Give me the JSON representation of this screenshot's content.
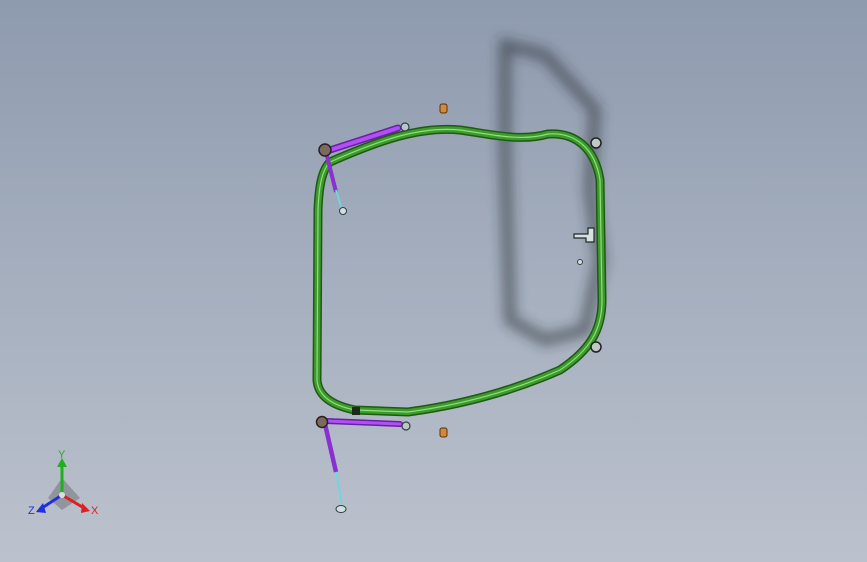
{
  "scene": {
    "background_top": "#8e9aae",
    "background_bottom": "#bcc2cd",
    "model": "frame-assembly",
    "colors": {
      "frame": "#3f9a2e",
      "frame_dark": "#1e5a14",
      "strut": "#9a2fd8",
      "rod": "#6fd6e0",
      "fitting": "#d08a3a",
      "shadow": "#2c2f36"
    }
  },
  "triad": {
    "x_label": "X",
    "y_label": "Y",
    "z_label": "Z",
    "x_color": "#e02020",
    "y_color": "#20b020",
    "z_color": "#2030e0"
  }
}
